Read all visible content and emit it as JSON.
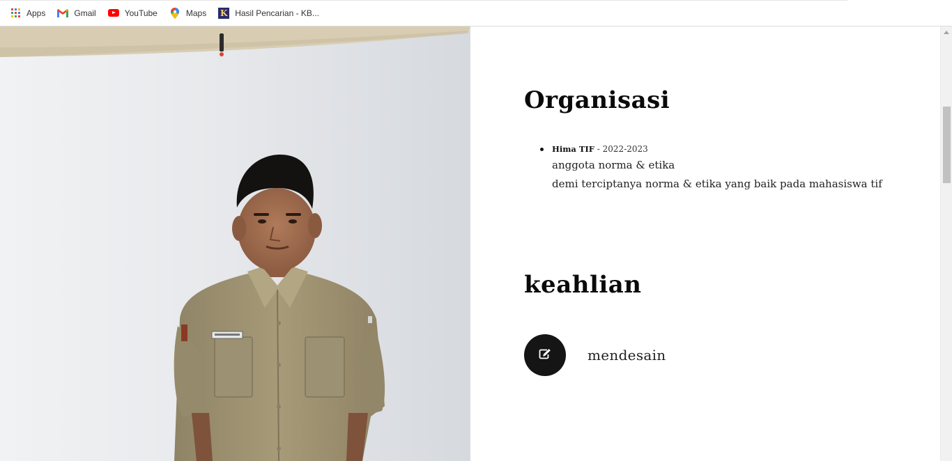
{
  "bookmarks": [
    {
      "label": "Apps",
      "icon": "apps-grid-icon"
    },
    {
      "label": "Gmail",
      "icon": "gmail-icon"
    },
    {
      "label": "YouTube",
      "icon": "youtube-icon"
    },
    {
      "label": "Maps",
      "icon": "maps-pin-icon"
    },
    {
      "label": "Hasil Pencarian - KB...",
      "icon": "kbbi-k-icon"
    }
  ],
  "colors": {
    "accent_dark": "#151515",
    "apps_dots": [
      "#ea4335",
      "#4285f4",
      "#fbbc05",
      "#34a853",
      "#ea4335",
      "#4285f4",
      "#fbbc05",
      "#34a853",
      "#ea4335"
    ],
    "youtube_red": "#ff0000",
    "kbbi_bg": "#2c2a6b"
  },
  "photo": {
    "subject": "portrait-photo",
    "alt": ""
  },
  "organisasi": {
    "title": "Organisasi",
    "items": [
      {
        "name": "Hima TIF",
        "separator": " - ",
        "years": "2022-2023",
        "role": "anggota norma & etika",
        "description": "demi terciptanya norma & etika yang baik pada mahasiswa tif"
      }
    ]
  },
  "keahlian": {
    "title": "keahlian",
    "skills": [
      {
        "label": "mendesain",
        "icon": "edit-icon"
      }
    ]
  }
}
